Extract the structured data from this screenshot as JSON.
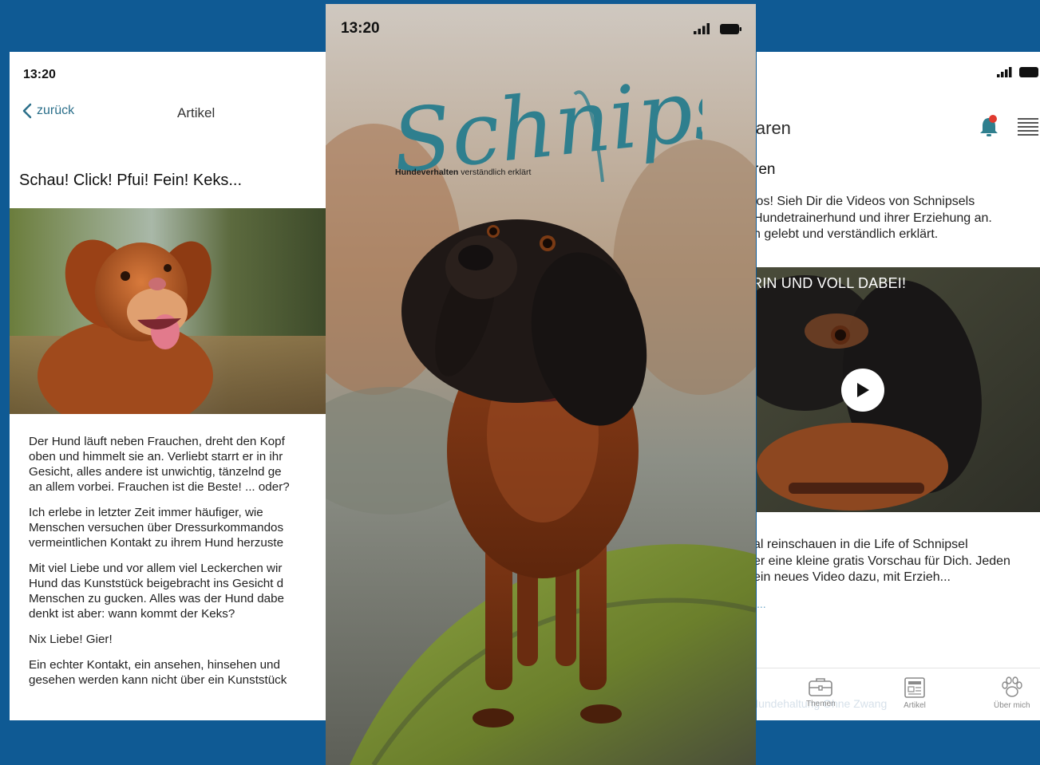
{
  "left_screen": {
    "status_time": "13:20",
    "back_label": "zurück",
    "nav_title": "Artikel",
    "article_title": "Schau! Click! Pfui! Fein! Keks...",
    "paragraphs": {
      "p1": [
        "Der Hund läuft neben Frauchen, dreht den Kopf",
        "oben und himmelt sie an. Verliebt starrt er in ihr",
        "Gesicht, alles andere ist unwichtig, tänzelnd ge",
        "an allem vorbei. Frauchen ist die Beste! ... oder?"
      ],
      "p2": [
        "Ich erlebe in letzter Zeit immer häufiger, wie",
        "Menschen versuchen über Dressurkommandos",
        "vermeintlichen Kontakt zu ihrem Hund herzuste"
      ],
      "p3": [
        "Mit viel Liebe und vor allem viel Leckerchen wir",
        "Hund das Kunststück beigebracht ins Gesicht d",
        "Menschen zu gucken. Alles was der Hund dabe",
        "denkt ist aber: wann kommt der Keks?"
      ],
      "p4": [
        "Nix Liebe! Gier!"
      ],
      "p5": [
        "Ein echter Kontakt, ein ansehen, hinsehen und",
        "gesehen werden kann nicht über ein Kunststück"
      ]
    }
  },
  "center_screen": {
    "status_time": "13:20",
    "logo_text": "Schnipsel",
    "tagline_bold": "Hundeverhalten",
    "tagline_rest": " verständlich erklärt"
  },
  "right_screen": {
    "header_title": "laren",
    "subhead": "ren",
    "intro_lines": [
      "los! Sieh Dir die Videos von Schnipsels",
      "Hundetrainerhund und ihrer Erziehung an.",
      "n gelebt und verständlich erklärt."
    ],
    "video_caption": "RIN UND VOLL DABEI!",
    "teaser_lines": [
      "al reinschauen in die Life of Schnipsel",
      "er eine kleine gratis Vorschau für Dich. Jeden",
      " ein neues Video dazu, mit Erzieh..."
    ],
    "more_label": "...",
    "ghost_text": "Hundehaltung Ohne Zwang",
    "tabs": {
      "themen": "Themen",
      "artikel": "Artikel",
      "ueber_mich": "Über mich"
    }
  },
  "colors": {
    "background": "#0f5a94",
    "accent_teal": "#2f7f8e",
    "notification": "#e03a2f",
    "link": "#2b6f8a"
  }
}
